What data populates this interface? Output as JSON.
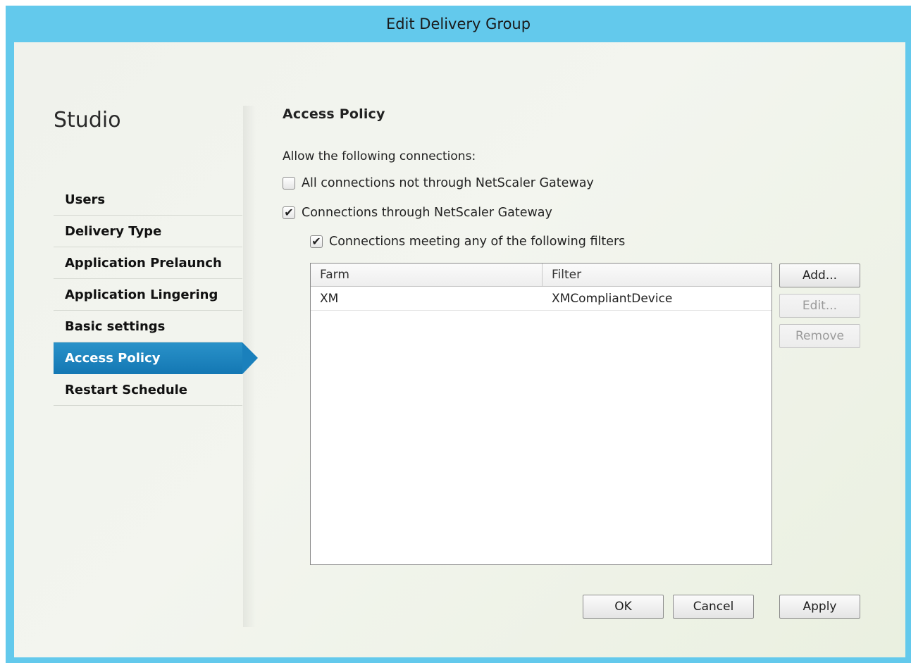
{
  "window": {
    "title": "Edit Delivery Group"
  },
  "sidebar": {
    "brand": "Studio",
    "items": [
      {
        "label": "Users",
        "active": false
      },
      {
        "label": "Delivery Type",
        "active": false
      },
      {
        "label": "Application Prelaunch",
        "active": false
      },
      {
        "label": "Application Lingering",
        "active": false
      },
      {
        "label": "Basic settings",
        "active": false
      },
      {
        "label": "Access Policy",
        "active": true
      },
      {
        "label": "Restart Schedule",
        "active": false
      }
    ]
  },
  "main": {
    "title": "Access Policy",
    "allow_label": "Allow the following connections:",
    "checkbox_not_gateway": {
      "label": "All connections not through NetScaler Gateway",
      "checked": false
    },
    "checkbox_gateway": {
      "label": "Connections through NetScaler Gateway",
      "checked": true
    },
    "checkbox_filters": {
      "label": "Connections meeting any of the following filters",
      "checked": true
    },
    "grid": {
      "columns": [
        "Farm",
        "Filter"
      ],
      "rows": [
        {
          "farm": "XM",
          "filter": "XMCompliantDevice"
        }
      ]
    },
    "side_buttons": {
      "add": "Add...",
      "edit": "Edit...",
      "remove": "Remove"
    }
  },
  "footer": {
    "ok": "OK",
    "cancel": "Cancel",
    "apply": "Apply"
  },
  "colors": {
    "titlebar": "#63c9ec",
    "nav_active": "#1a80bc"
  },
  "icons": {
    "check": "check-mark-icon"
  }
}
